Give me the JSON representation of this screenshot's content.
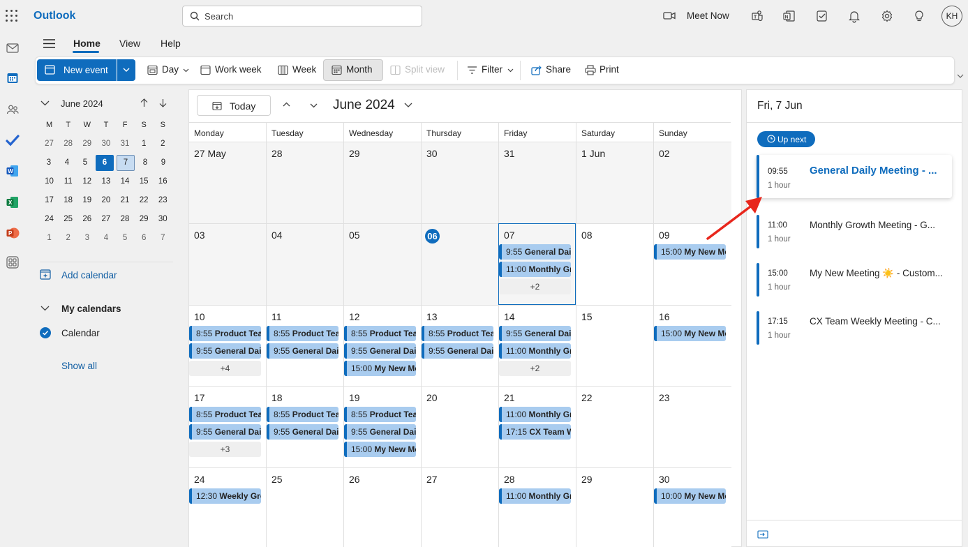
{
  "app": {
    "name": "Outlook"
  },
  "search": {
    "placeholder": "Search"
  },
  "topbar": {
    "meet_now": "Meet Now",
    "avatar": "KH"
  },
  "tabs": [
    "Home",
    "View",
    "Help"
  ],
  "ribbon": {
    "new_event": "New event",
    "day": "Day",
    "work_week": "Work week",
    "week": "Week",
    "month": "Month",
    "split_view": "Split view",
    "filter": "Filter",
    "share": "Share",
    "print": "Print"
  },
  "mini_calendar": {
    "title": "June 2024",
    "weekdays": [
      "M",
      "T",
      "W",
      "T",
      "F",
      "S",
      "S"
    ],
    "weeks": [
      [
        "27",
        "28",
        "29",
        "30",
        "31",
        "1",
        "2"
      ],
      [
        "3",
        "4",
        "5",
        "6",
        "7",
        "8",
        "9"
      ],
      [
        "10",
        "11",
        "12",
        "13",
        "14",
        "15",
        "16"
      ],
      [
        "17",
        "18",
        "19",
        "20",
        "21",
        "22",
        "23"
      ],
      [
        "24",
        "25",
        "26",
        "27",
        "28",
        "29",
        "30"
      ],
      [
        "1",
        "2",
        "3",
        "4",
        "5",
        "6",
        "7"
      ]
    ],
    "today": "6",
    "selected": "7"
  },
  "left": {
    "add_calendar": "Add calendar",
    "my_calendars": "My calendars",
    "calendar": "Calendar",
    "show_all": "Show all"
  },
  "main": {
    "today": "Today",
    "month_title": "June 2024",
    "weekdays": [
      "Monday",
      "Tuesday",
      "Wednesday",
      "Thursday",
      "Friday",
      "Saturday",
      "Sunday"
    ],
    "weeks": [
      {
        "days": [
          {
            "label": "27 May",
            "past": true,
            "events": []
          },
          {
            "label": "28",
            "past": true,
            "events": []
          },
          {
            "label": "29",
            "past": true,
            "events": []
          },
          {
            "label": "30",
            "past": true,
            "events": []
          },
          {
            "label": "31",
            "past": true,
            "events": []
          },
          {
            "label": "1 Jun",
            "past": true,
            "events": []
          },
          {
            "label": "02",
            "past": true,
            "events": []
          }
        ]
      },
      {
        "days": [
          {
            "label": "03",
            "past": true,
            "events": []
          },
          {
            "label": "04",
            "past": true,
            "events": []
          },
          {
            "label": "05",
            "past": true,
            "events": []
          },
          {
            "label": "06",
            "past": true,
            "today": true,
            "events": []
          },
          {
            "label": "07",
            "past": true,
            "selected": true,
            "events": [
              {
                "time": "9:55",
                "title": "General Daily Meeting"
              },
              {
                "time": "11:00",
                "title": "Monthly Growth Meeting"
              }
            ],
            "more": "+2"
          },
          {
            "label": "08",
            "events": []
          },
          {
            "label": "09",
            "events": [
              {
                "time": "15:00",
                "title": "My New Meeting"
              }
            ]
          }
        ]
      },
      {
        "days": [
          {
            "label": "10",
            "events": [
              {
                "time": "8:55",
                "title": "Product Team"
              },
              {
                "time": "9:55",
                "title": "General Daily Meeting"
              }
            ],
            "more": "+4"
          },
          {
            "label": "11",
            "events": [
              {
                "time": "8:55",
                "title": "Product Team"
              },
              {
                "time": "9:55",
                "title": "General Daily Meeting"
              }
            ]
          },
          {
            "label": "12",
            "events": [
              {
                "time": "8:55",
                "title": "Product Team"
              },
              {
                "time": "9:55",
                "title": "General Daily Meeting"
              },
              {
                "time": "15:00",
                "title": "My New Meeting"
              }
            ]
          },
          {
            "label": "13",
            "events": [
              {
                "time": "8:55",
                "title": "Product Team"
              },
              {
                "time": "9:55",
                "title": "General Daily Meeting"
              }
            ]
          },
          {
            "label": "14",
            "events": [
              {
                "time": "9:55",
                "title": "General Daily Meeting"
              },
              {
                "time": "11:00",
                "title": "Monthly Growth Meeting"
              }
            ],
            "more": "+2"
          },
          {
            "label": "15",
            "events": []
          },
          {
            "label": "16",
            "events": [
              {
                "time": "15:00",
                "title": "My New Meeting"
              }
            ]
          }
        ]
      },
      {
        "days": [
          {
            "label": "17",
            "events": [
              {
                "time": "8:55",
                "title": "Product Team"
              },
              {
                "time": "9:55",
                "title": "General Daily Meeting"
              }
            ],
            "more": "+3"
          },
          {
            "label": "18",
            "events": [
              {
                "time": "8:55",
                "title": "Product Team"
              },
              {
                "time": "9:55",
                "title": "General Daily Meeting"
              }
            ]
          },
          {
            "label": "19",
            "events": [
              {
                "time": "8:55",
                "title": "Product Team"
              },
              {
                "time": "9:55",
                "title": "General Daily Meeting"
              },
              {
                "time": "15:00",
                "title": "My New Meeting"
              }
            ]
          },
          {
            "label": "20",
            "events": []
          },
          {
            "label": "21",
            "events": [
              {
                "time": "11:00",
                "title": "Monthly Growth Meeting"
              },
              {
                "time": "17:15",
                "title": "CX Team Weekly Meeting"
              }
            ]
          },
          {
            "label": "22",
            "events": []
          },
          {
            "label": "23",
            "events": []
          }
        ]
      },
      {
        "days": [
          {
            "label": "24",
            "events": [
              {
                "time": "12:30",
                "title": "Weekly Group"
              }
            ]
          },
          {
            "label": "25",
            "events": []
          },
          {
            "label": "26",
            "events": []
          },
          {
            "label": "27",
            "events": []
          },
          {
            "label": "28",
            "events": [
              {
                "time": "11:00",
                "title": "Monthly Growth Meeting"
              }
            ]
          },
          {
            "label": "29",
            "events": []
          },
          {
            "label": "30",
            "events": [
              {
                "time": "10:00",
                "title": "My New Meeting"
              }
            ]
          }
        ]
      }
    ]
  },
  "right": {
    "date": "Fri, 7 Jun",
    "up_next": "Up next",
    "agenda": [
      {
        "time": "09:55",
        "duration": "1 hour",
        "title": "General Daily Meeting - ..."
      },
      {
        "time": "11:00",
        "duration": "1 hour",
        "title": "Monthly Growth Meeting - G..."
      },
      {
        "time": "15:00",
        "duration": "1 hour",
        "title": "My New Meeting ☀️ - Custom..."
      },
      {
        "time": "17:15",
        "duration": "1 hour",
        "title": "CX Team Weekly Meeting - C..."
      }
    ]
  },
  "colors": {
    "accent": "#0f6cbd",
    "event_bg": "#a9ccef",
    "annotation_arrow": "#e8261c"
  }
}
